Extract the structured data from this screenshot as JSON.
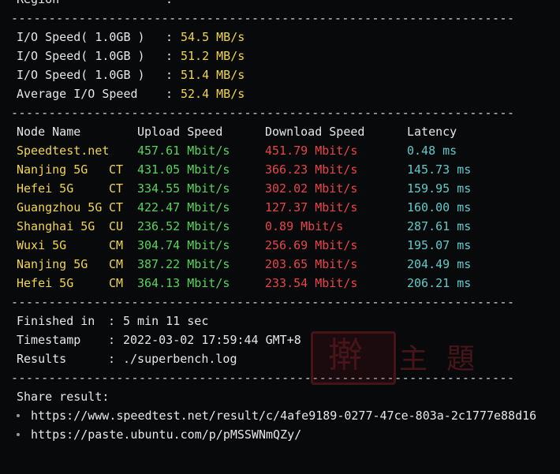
{
  "cut_line": {
    "label": "Region",
    "colon": ":"
  },
  "separator": "-------------------------------------------------------------------",
  "io": [
    {
      "label": "I/O Speed( 1.0GB )",
      "colon": ":",
      "value": "54.5 MB/s"
    },
    {
      "label": "I/O Speed( 1.0GB )",
      "colon": ":",
      "value": "51.2 MB/s"
    },
    {
      "label": "I/O Speed( 1.0GB )",
      "colon": ":",
      "value": "51.4 MB/s"
    },
    {
      "label": "Average I/O Speed",
      "colon": ":",
      "value": "52.4 MB/s"
    }
  ],
  "table": {
    "headers": {
      "node": "Node Name",
      "upload": "Upload Speed",
      "download": "Download Speed",
      "latency": "Latency"
    },
    "rows": [
      {
        "node": "Speedtest.net",
        "isp": "",
        "upload": "457.61 Mbit/s",
        "download": "451.79 Mbit/s",
        "latency": "0.48 ms"
      },
      {
        "node": "Nanjing 5G",
        "isp": "CT",
        "upload": "431.05 Mbit/s",
        "download": "366.23 Mbit/s",
        "latency": "145.73 ms"
      },
      {
        "node": "Hefei 5G",
        "isp": "CT",
        "upload": "334.55 Mbit/s",
        "download": "302.02 Mbit/s",
        "latency": "159.95 ms"
      },
      {
        "node": "Guangzhou 5G",
        "isp": "CT",
        "upload": "422.47 Mbit/s",
        "download": "127.37 Mbit/s",
        "latency": "160.00 ms"
      },
      {
        "node": "Shanghai 5G",
        "isp": "CU",
        "upload": "236.52 Mbit/s",
        "download": "0.89 Mbit/s",
        "latency": "287.61 ms"
      },
      {
        "node": "Wuxi 5G",
        "isp": "CM",
        "upload": "304.74 Mbit/s",
        "download": "256.69 Mbit/s",
        "latency": "195.07 ms"
      },
      {
        "node": "Nanjing 5G",
        "isp": "CM",
        "upload": "387.22 Mbit/s",
        "download": "203.65 Mbit/s",
        "latency": "204.49 ms"
      },
      {
        "node": "Hefei 5G",
        "isp": "CM",
        "upload": "364.13 Mbit/s",
        "download": "233.54 Mbit/s",
        "latency": "206.21 ms"
      }
    ]
  },
  "meta": [
    {
      "label": "Finished in",
      "colon": ":",
      "value": "5 min 11 sec"
    },
    {
      "label": "Timestamp",
      "colon": ":",
      "value": "2022-03-02 17:59:44 GMT+8"
    },
    {
      "label": "Results",
      "colon": ":",
      "value": "./superbench.log"
    }
  ],
  "share": {
    "title": "Share result:",
    "links": [
      "https://www.speedtest.net/result/c/4afe9189-0277-47ce-803a-2c1777e88d16",
      "https://paste.ubuntu.com/p/pMSSWNmQZy/"
    ]
  },
  "watermark": {
    "glyphs": [
      "擀",
      "主",
      "題"
    ]
  },
  "colors": {
    "background": "#08090b",
    "yellow": "#f2d54a",
    "green": "#57d45a",
    "red": "#e84646",
    "cyan": "#60c9c9",
    "watermark": "#7c1f26"
  }
}
